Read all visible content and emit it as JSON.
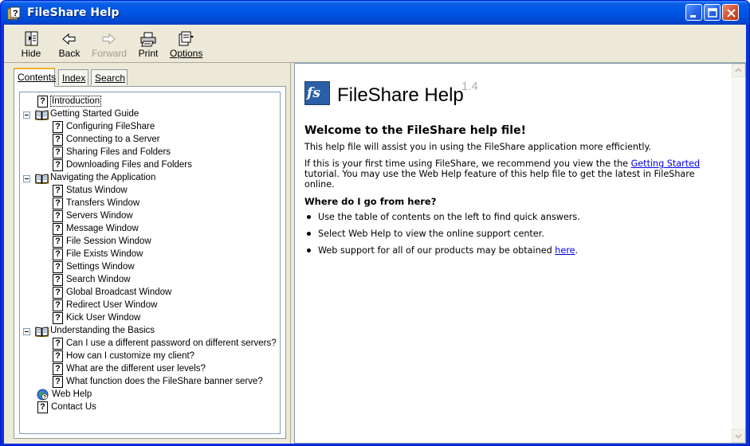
{
  "window": {
    "title": "FileShare Help"
  },
  "toolbar": {
    "hide": "Hide",
    "back": "Back",
    "forward": "Forward",
    "print": "Print",
    "options": "Options"
  },
  "tabs": {
    "contents": "Contents",
    "index": "Index",
    "search": "Search",
    "active": "Contents"
  },
  "tree": [
    {
      "label": "Introduction",
      "type": "page",
      "level": 1,
      "selected": true
    },
    {
      "label": "Getting Started Guide",
      "type": "book",
      "level": 0
    },
    {
      "label": "Configuring FileShare",
      "type": "page",
      "level": 2
    },
    {
      "label": "Connecting to a Server",
      "type": "page",
      "level": 2
    },
    {
      "label": "Sharing Files and Folders",
      "type": "page",
      "level": 2
    },
    {
      "label": "Downloading Files and Folders",
      "type": "page",
      "level": 2
    },
    {
      "label": "Navigating the Application",
      "type": "book",
      "level": 0
    },
    {
      "label": "Status Window",
      "type": "page",
      "level": 2
    },
    {
      "label": "Transfers Window",
      "type": "page",
      "level": 2
    },
    {
      "label": "Servers Window",
      "type": "page",
      "level": 2
    },
    {
      "label": "Message Window",
      "type": "page",
      "level": 2
    },
    {
      "label": "File Session Window",
      "type": "page",
      "level": 2
    },
    {
      "label": "File Exists Window",
      "type": "page",
      "level": 2
    },
    {
      "label": "Settings Window",
      "type": "page",
      "level": 2
    },
    {
      "label": "Search Window",
      "type": "page",
      "level": 2
    },
    {
      "label": "Global Broadcast Window",
      "type": "page",
      "level": 2
    },
    {
      "label": "Redirect User Window",
      "type": "page",
      "level": 2
    },
    {
      "label": "Kick User Window",
      "type": "page",
      "level": 2
    },
    {
      "label": "Understanding the Basics",
      "type": "book",
      "level": 0
    },
    {
      "label": "Can I use a different password on different servers?",
      "type": "page",
      "level": 2
    },
    {
      "label": "How can I customize my client?",
      "type": "page",
      "level": 2
    },
    {
      "label": "What are the different user levels?",
      "type": "page",
      "level": 2
    },
    {
      "label": "What function does the FileShare banner serve?",
      "type": "page",
      "level": 2
    },
    {
      "label": "Web Help",
      "type": "web",
      "level": 1
    },
    {
      "label": "Contact Us",
      "type": "page",
      "level": 1
    }
  ],
  "content": {
    "logo": "fs",
    "brand": "FileShare Help",
    "version": "1.4",
    "heading": "Welcome to the FileShare help file!",
    "intro": "This help file will assist you in using the FileShare application more efficiently.",
    "first_time_pre": "If this is your first time using FileShare, we recommend you view the the ",
    "first_time_link": "Getting Started",
    "first_time_post": " tutorial. You may use the Web Help feature of this help file to get the latest in FileShare online.",
    "subheading": "Where do I go from here?",
    "bullets": [
      "Use the table of contents on the left to find quick answers.",
      "Select Web Help to view the online support center."
    ],
    "bullet3_pre": "Web support for all of our products may be obtained ",
    "bullet3_link": "here",
    "bullet3_post": "."
  }
}
